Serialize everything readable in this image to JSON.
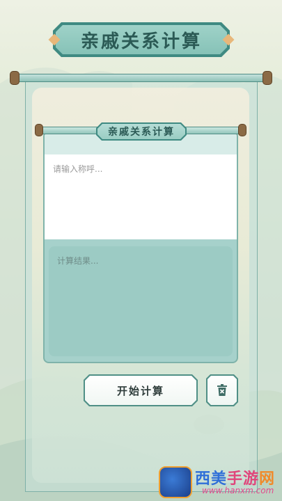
{
  "header": {
    "title": "亲戚关系计算"
  },
  "card": {
    "banner_label": "亲戚关系计算",
    "input_placeholder": "请输入称呼...",
    "input_value": "",
    "result_placeholder": "计算结果..."
  },
  "actions": {
    "calculate_label": "开始计算",
    "clear_icon": "trash-icon"
  },
  "watermark": {
    "name_part1": "西美",
    "name_part2": "手游",
    "name_part3": "网",
    "url": "www.hanxm.com"
  },
  "colors": {
    "primary_teal": "#3f8a82",
    "banner_fill": "#9fd2c8",
    "result_bg": "#9ccbc4",
    "wood": "#8b6a45"
  }
}
